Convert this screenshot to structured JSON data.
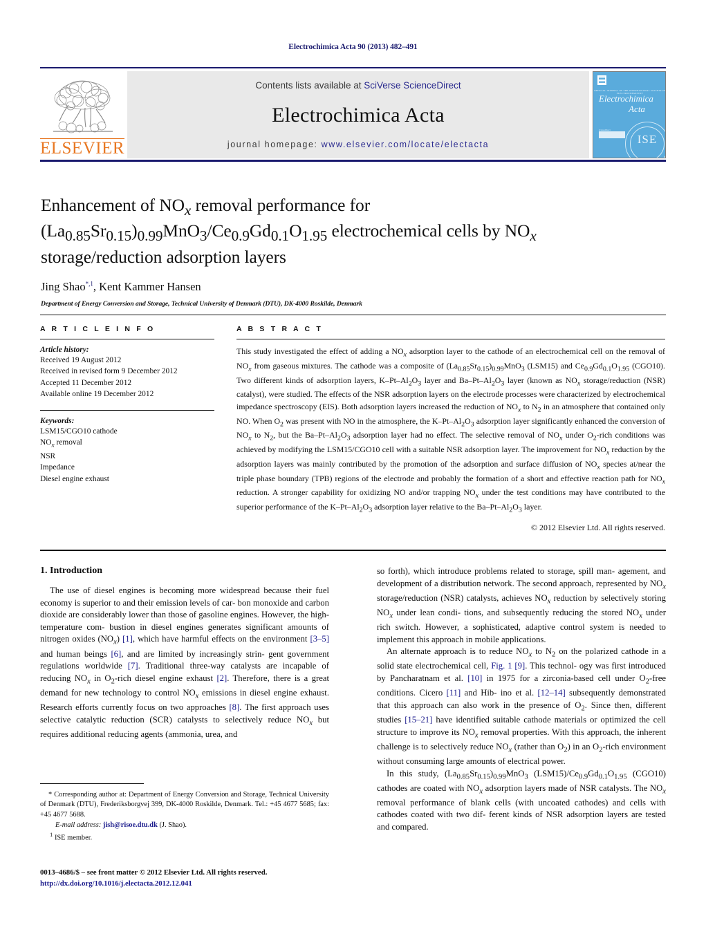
{
  "running_head": "Electrochimica Acta 90 (2013) 482–491",
  "masthead": {
    "contents_prefix": "Contents lists available at ",
    "contents_link": "SciVerse ScienceDirect",
    "journal_title": "Electrochimica Acta",
    "homepage_prefix": "journal homepage: ",
    "homepage_link": "www.elsevier.com/locate/electacta",
    "publisher_logo_text": "ELSEVIER",
    "cover": {
      "society_line": "OFFICIAL JOURNAL OF THE INTERNATIONAL SOCIETY OF ELECTROCHEMISTRY",
      "title_line1": "Electrochimica",
      "title_line2": "Acta",
      "badge_label": "ScienceDirect",
      "society_logo": "ISE"
    }
  },
  "article": {
    "title_line1": "Enhancement of NO",
    "title_sub_x1": "x",
    "title_line1b": " removal performance for",
    "title_line2_html": "(La0.85Sr0.15)0.99MnO3/Ce0.9Gd0.1O1.95 electrochemical cells by NOx",
    "title_line3": "storage/reduction adsorption layers",
    "authors": "Jing Shao, Kent Kammer Hansen",
    "author1": "Jing Shao",
    "author1_marks": "*, 1",
    "author2": ", Kent Kammer Hansen",
    "affiliation": "Department of Energy Conversion and Storage, Technical University of Denmark (DTU), DK-4000 Roskilde, Denmark"
  },
  "article_info": {
    "label": "A R T I C L E   I N F O",
    "history_head": "Article history:",
    "history": [
      "Received 19 August 2012",
      "Received in revised form 9 December 2012",
      "Accepted 11 December 2012",
      "Available online 19 December 2012"
    ],
    "keywords_head": "Keywords:",
    "keywords": [
      "LSM15/CGO10 cathode",
      "NOx removal",
      "NSR",
      "Impedance",
      "Diesel engine exhaust"
    ]
  },
  "abstract": {
    "label": "A B S T R A C T",
    "copyright": "© 2012 Elsevier Ltd. All rights reserved."
  },
  "introduction": {
    "heading": "1. Introduction"
  },
  "footnotes": {
    "corresponding": "* Corresponding author at: Department of Energy Conversion and Storage, Technical University of Denmark (DTU), Frederiksborgvej 399, DK-4000 Roskilde, Denmark. Tel.: +45 4677 5685; fax: +45 4677 5688.",
    "email_label": "E-mail address:",
    "email": "jish@risoe.dtu.dk",
    "email_suffix": "(J. Shao).",
    "footnote1_marker": "1",
    "footnote1": "ISE member."
  },
  "imprint": {
    "line1": "0013–4686/$ – see front matter © 2012 Elsevier Ltd. All rights reserved.",
    "doi": "http://dx.doi.org/10.1016/j.electacta.2012.12.041"
  },
  "colors": {
    "link": "#1b1b8c",
    "rule": "#1a1a6e",
    "elsevier_orange": "#E87722",
    "cover_blue": "#5aabdc"
  }
}
